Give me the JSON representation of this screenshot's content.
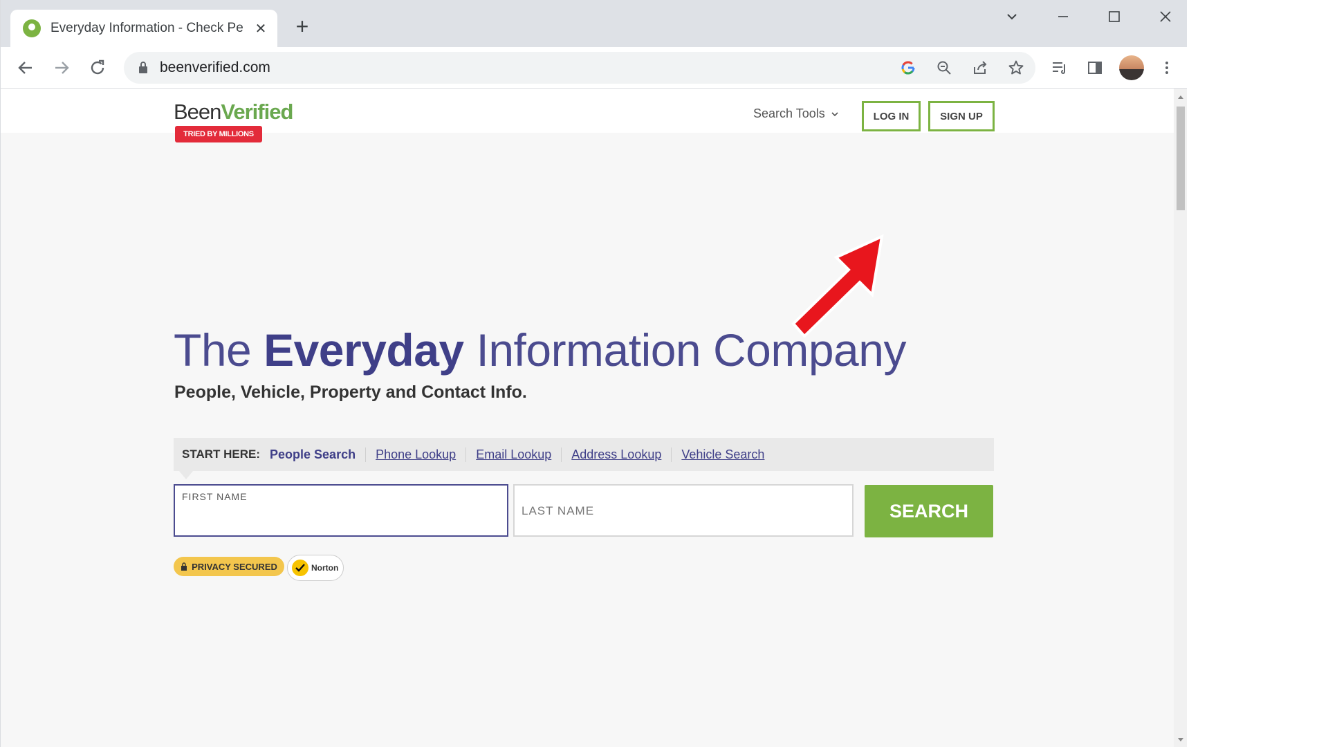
{
  "browser": {
    "tab": {
      "title": "Everyday Information - Check Pe",
      "close_icon": "close-icon"
    },
    "new_tab_icon": "plus-icon",
    "window_controls": [
      "chevron-down-icon",
      "minimize-icon",
      "maximize-icon",
      "close-icon"
    ],
    "url": "beenverified.com",
    "toolbar_icons": [
      "google-icon",
      "zoom-icon",
      "share-icon",
      "star-icon",
      "reading-list-icon",
      "side-panel-icon",
      "profile-avatar",
      "more-menu-icon"
    ]
  },
  "site": {
    "logo": {
      "text_plain": "Been",
      "text_accent": "Verified",
      "badge": "TRIED BY MILLIONS"
    },
    "nav": {
      "search_tools": "Search Tools",
      "log_in": "LOG IN",
      "sign_up": "SIGN UP"
    },
    "hero": {
      "title_pre": "The ",
      "title_bold": "Everyday",
      "title_post": " Information Company",
      "subtitle": "People, Vehicle, Property and Contact Info."
    },
    "start_here": {
      "label": "START HERE:",
      "links": [
        "People Search",
        "Phone Lookup",
        "Email Lookup",
        "Address Lookup",
        "Vehicle Search"
      ]
    },
    "form": {
      "first_name_label": "FIRST NAME",
      "last_name_label": "LAST NAME",
      "search_button": "SEARCH"
    },
    "trust": {
      "privacy": "PRIVACY SECURED",
      "norton": "Norton"
    }
  },
  "colors": {
    "brand_green": "#7cb342",
    "brand_purple": "#4b4b8f",
    "annotation_arrow": "#e8161d"
  }
}
